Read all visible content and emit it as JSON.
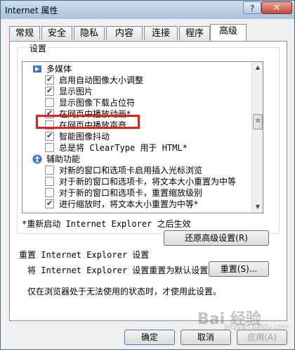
{
  "window": {
    "title": "Internet 属性",
    "help_label": "?",
    "close_label": "✕"
  },
  "tabs": [
    {
      "label": "常规"
    },
    {
      "label": "安全"
    },
    {
      "label": "隐私"
    },
    {
      "label": "内容"
    },
    {
      "label": "连接"
    },
    {
      "label": "程序"
    },
    {
      "label": "高级"
    }
  ],
  "settings": {
    "group_label": "设置",
    "items": [
      {
        "type": "category",
        "icon": "multimedia-icon",
        "label": "多媒体"
      },
      {
        "type": "checkbox",
        "checked": true,
        "label": "启用自动图像大小调整"
      },
      {
        "type": "checkbox",
        "checked": true,
        "label": "显示图片"
      },
      {
        "type": "checkbox",
        "checked": false,
        "label": "显示图像下载占位符"
      },
      {
        "type": "checkbox",
        "checked": true,
        "label": "在网页中播放动画*"
      },
      {
        "type": "checkbox",
        "checked": false,
        "label": "在网页中播放声音",
        "highlighted": true
      },
      {
        "type": "checkbox",
        "checked": true,
        "label": "智能图像抖动"
      },
      {
        "type": "checkbox",
        "checked": false,
        "label": "总是将 ClearType 用于 HTML*"
      },
      {
        "type": "category",
        "icon": "accessibility-icon",
        "label": "辅助功能"
      },
      {
        "type": "checkbox",
        "checked": false,
        "label": "对新的窗口和选项卡启用插入光标浏览"
      },
      {
        "type": "checkbox",
        "checked": false,
        "label": "对于新的窗口和选项卡，将文本大小重置为中等"
      },
      {
        "type": "checkbox",
        "checked": false,
        "label": "对于新的窗口和选项卡，重置缩放级别"
      },
      {
        "type": "checkbox",
        "checked": true,
        "label": "进行缩放时，将文本大小重置为中等*"
      }
    ],
    "restart_note": "*重新启动 Internet Explorer 之后生效",
    "restore_button": "还原高级设置(R)"
  },
  "reset": {
    "heading": "重置 Internet Explorer 设置",
    "description": "将 Internet Explorer 设置重置为默认设置。",
    "button": "重置(S)...",
    "note": "仅在浏览器处于无法使用的状态时，才使用此设置。"
  },
  "footer": {
    "ok": "确定",
    "cancel": "取消",
    "apply": "应用(A)"
  },
  "watermark": {
    "text": "Bai 经验",
    "sub": "jingyan.baidu.com"
  },
  "colors": {
    "highlight_box": "#e8201c",
    "check": "#1e3f7a"
  }
}
